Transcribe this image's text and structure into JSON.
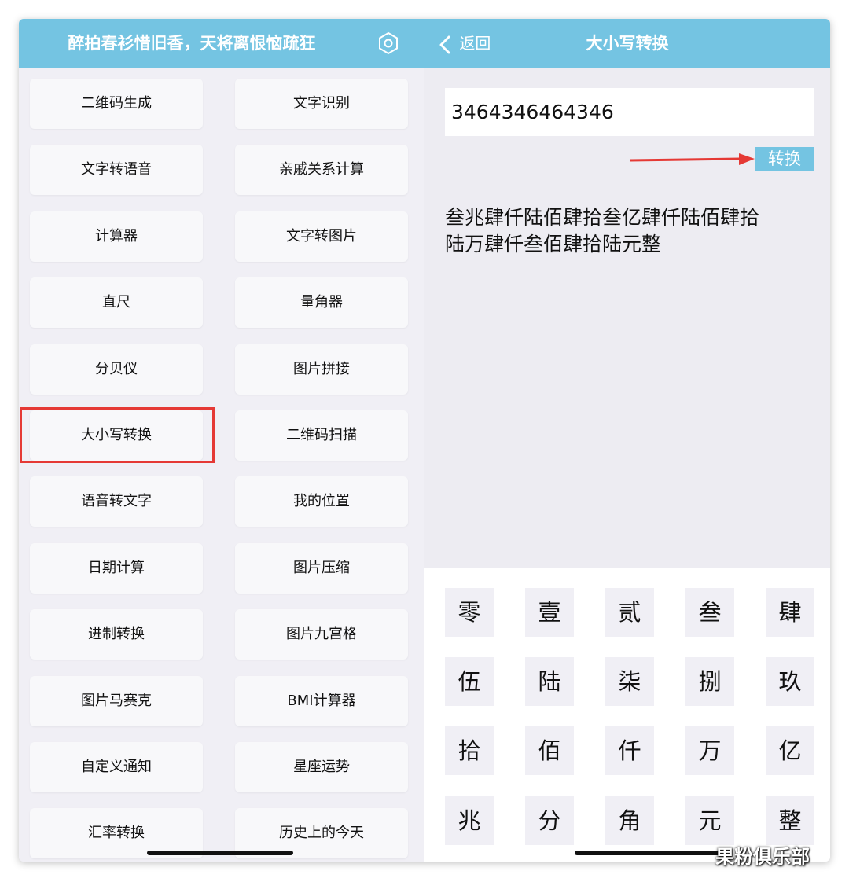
{
  "left": {
    "header_title": "醉拍春衫惜旧香，天将离恨恼疏狂",
    "settings_icon": "hexagon-settings-icon",
    "tools": [
      [
        "二维码生成",
        "文字识别"
      ],
      [
        "文字转语音",
        "亲戚关系计算"
      ],
      [
        "计算器",
        "文字转图片"
      ],
      [
        "直尺",
        "量角器"
      ],
      [
        "分贝仪",
        "图片拼接"
      ],
      [
        "大小写转换",
        "二维码扫描"
      ],
      [
        "语音转文字",
        "我的位置"
      ],
      [
        "日期计算",
        "图片压缩"
      ],
      [
        "进制转换",
        "图片九宫格"
      ],
      [
        "图片马赛克",
        "BMI计算器"
      ],
      [
        "自定义通知",
        "星座运势"
      ],
      [
        "汇率转换",
        "历史上的今天"
      ]
    ],
    "highlighted_tool": "大小写转换"
  },
  "right": {
    "back_label": "返回",
    "title": "大小写转换",
    "input_value": "3464346464346",
    "convert_label": "转换",
    "result_lines": [
      "叁兆肆仟陆佰肆拾叁亿肆仟陆佰肆拾",
      "陆万肆仟叁佰肆拾陆元整"
    ],
    "keys": [
      [
        "零",
        "壹",
        "贰",
        "叁",
        "肆"
      ],
      [
        "伍",
        "陆",
        "柒",
        "捌",
        "玖"
      ],
      [
        "拾",
        "佰",
        "仟",
        "万",
        "亿"
      ],
      [
        "兆",
        "分",
        "角",
        "元",
        "整"
      ]
    ]
  },
  "colors": {
    "header": "#74c4e2",
    "highlight": "#e53935",
    "arrow": "#e53935"
  },
  "watermark": "果粉俱乐部"
}
